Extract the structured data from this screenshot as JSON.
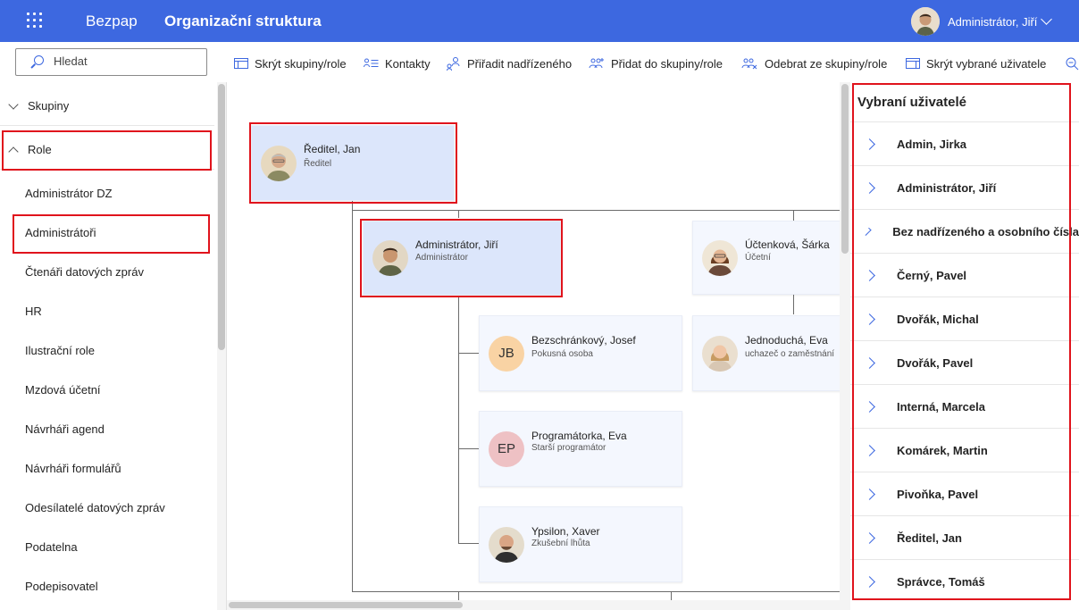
{
  "header": {
    "app_name": "Bezpap",
    "page_title": "Organizační struktura",
    "user_name": "Administrátor, Jiří"
  },
  "toolbar": {
    "search_placeholder": "Hledat",
    "buttons": [
      {
        "label": "Skrýt skupiny/role",
        "icon": "panel-icon"
      },
      {
        "label": "Kontakty",
        "icon": "contacts-list-icon"
      },
      {
        "label": "Přiřadit nadřízeného",
        "icon": "assign-manager-icon"
      },
      {
        "label": "Přidat do skupiny/role",
        "icon": "add-group-icon"
      },
      {
        "label": "Odebrat ze skupiny/role",
        "icon": "remove-group-icon"
      },
      {
        "label": "Skrýt vybrané uživatele",
        "icon": "panel-icon"
      }
    ]
  },
  "sidebar": {
    "groups_label": "Skupiny",
    "roles_label": "Role",
    "roles": [
      "Administrátor DZ",
      "Administrátoři",
      "Čtenáři datových zpráv",
      "HR",
      "Ilustrační role",
      "Mzdová účetní",
      "Návrháři agend",
      "Návrháři formulářů",
      "Odesílatelé datových zpráv",
      "Podatelna",
      "Podepisovatel"
    ]
  },
  "org_chart": {
    "cards": [
      {
        "name": "Ředitel, Jan",
        "role": "Ředitel",
        "avatar": "photo"
      },
      {
        "name": "Administrátor, Jiří",
        "role": "Administrátor",
        "avatar": "photo"
      },
      {
        "name": "Účtenková, Šárka",
        "role": "Účetní",
        "avatar": "photo"
      },
      {
        "name": "Bezschránkový, Josef",
        "role": "Pokusná osoba",
        "initials": "JB",
        "color": "#f9d3a4"
      },
      {
        "name": "Jednoduchá, Eva",
        "role": "uchazeč o zaměstnání",
        "avatar": "photo"
      },
      {
        "name": "Programátorka, Eva",
        "role": "Starší programátor",
        "initials": "EP",
        "color": "#eec1c4"
      },
      {
        "name": "Ypsilon, Xaver",
        "role": "Zkušební lhůta",
        "avatar": "photo"
      }
    ]
  },
  "selected_panel": {
    "title": "Vybraní uživatelé",
    "users": [
      "Admin, Jirka",
      "Administrátor, Jiří",
      "Bez nadřízeného a osobního čísla",
      "Černý, Pavel",
      "Dvořák, Michal",
      "Dvořák, Pavel",
      "Interná, Marcela",
      "Komárek, Martin",
      "Pivoňka, Pavel",
      "Ředitel, Jan",
      "Správce, Tomáš"
    ]
  },
  "colors": {
    "accent": "#3d68e0",
    "highlight": "#e0131c",
    "card": "#f4f7fe",
    "card_selected": "#dce6fb"
  }
}
